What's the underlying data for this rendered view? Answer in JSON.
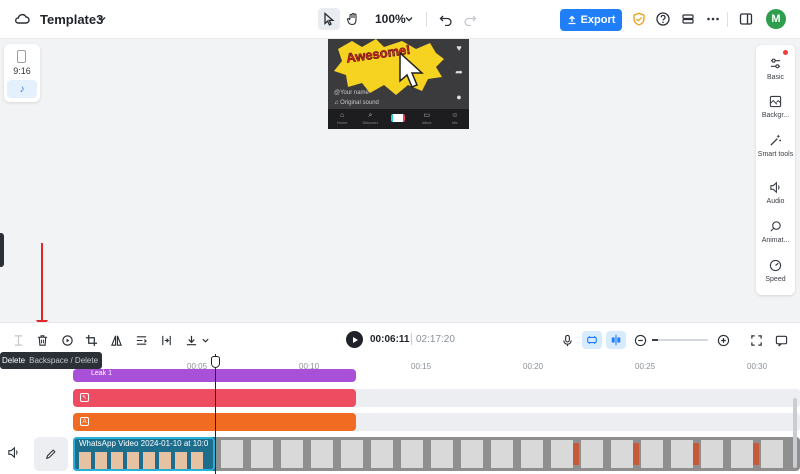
{
  "header": {
    "project_title": "Template3",
    "zoom_level": "100%",
    "export_label": "Export",
    "avatar_initial": "M"
  },
  "canvas": {
    "aspect_ratio_label": "9:16",
    "preview": {
      "sticker_text": "Awesome!",
      "username": "@Your name",
      "sound_label": "Original sound",
      "nav_items": [
        "Home",
        "Discover",
        "",
        "Inbox",
        "Me"
      ]
    }
  },
  "right_panel": {
    "items": [
      {
        "label": "Basic",
        "icon": "sliders-icon"
      },
      {
        "label": "Backgr...",
        "icon": "background-icon"
      },
      {
        "label": "Smart tools",
        "icon": "magic-wand-icon"
      },
      {
        "label": "Audio",
        "icon": "audio-icon"
      },
      {
        "label": "Animat...",
        "icon": "animation-icon"
      },
      {
        "label": "Speed",
        "icon": "speed-icon"
      }
    ]
  },
  "toolbar": {
    "current_time": "00:06:11",
    "total_time": "02:17:20",
    "tooltip": {
      "label": "Delete",
      "shortcut": "Backspace / Delete"
    }
  },
  "timeline": {
    "ruler_labels": [
      "00:05",
      "00:10",
      "00:15",
      "00:20",
      "00:25",
      "00:30"
    ],
    "tracks": [
      {
        "label": "Leak 1",
        "color": "#a950d8"
      },
      {
        "label": "",
        "color": "#ee4d61"
      },
      {
        "label": "",
        "color": "#f26b22"
      }
    ],
    "video_clip_label": "WhatsApp Video 2024-01-10 at 10:0"
  },
  "colors": {
    "accent": "#1f7ef8",
    "annotation_arrow": "#e2262b",
    "selected_clip_border": "#27b0d8"
  }
}
